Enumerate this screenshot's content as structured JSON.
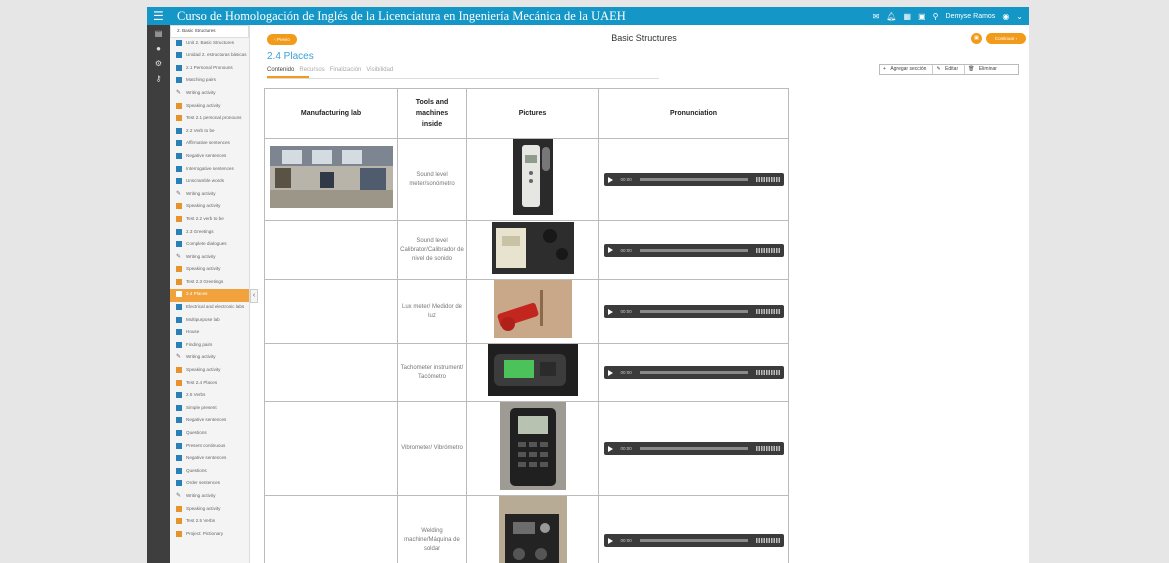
{
  "topbar": {
    "title": "Curso de Homologación de Inglés de la Licenciatura en Ingeniería Mecánica de la UAEH",
    "user": "Demyse Ramos"
  },
  "nav": {
    "items": [
      {
        "label": "2. Basic Structures",
        "kind": "head"
      },
      {
        "label": "Unit 2. Basic Structures",
        "kind": "doc"
      },
      {
        "label": "Unidad 2. estructuras básicas",
        "kind": "doc"
      },
      {
        "label": "2.1 Personal Pronouns",
        "kind": "doc"
      },
      {
        "label": "Matching pairs",
        "kind": "doc"
      },
      {
        "label": "Writing activity",
        "kind": "pen"
      },
      {
        "label": "Speaking activity",
        "kind": "spk"
      },
      {
        "label": "Test 2.1 personal pronouns",
        "kind": "spk"
      },
      {
        "label": "2.2 Verb to be",
        "kind": "doc"
      },
      {
        "label": "Affirmative sentences",
        "kind": "doc"
      },
      {
        "label": "Negative sentences",
        "kind": "doc"
      },
      {
        "label": "Interrogative sentences",
        "kind": "doc"
      },
      {
        "label": "Unscramble words",
        "kind": "doc"
      },
      {
        "label": "Writing activity",
        "kind": "pen"
      },
      {
        "label": "Speaking activity",
        "kind": "spk"
      },
      {
        "label": "Test 2.2 verb to be",
        "kind": "spk"
      },
      {
        "label": "2.3 Greetings",
        "kind": "doc"
      },
      {
        "label": "Complete dialogues",
        "kind": "doc"
      },
      {
        "label": "Writing activity",
        "kind": "pen"
      },
      {
        "label": "Speaking activity",
        "kind": "spk"
      },
      {
        "label": "Test 2.3 Greetings",
        "kind": "spk"
      },
      {
        "label": "2.4 Places",
        "kind": "active"
      },
      {
        "label": "Electrical and electronic labs",
        "kind": "doc"
      },
      {
        "label": "Multipurpose lab",
        "kind": "doc"
      },
      {
        "label": "House",
        "kind": "doc"
      },
      {
        "label": "Finding pairs",
        "kind": "doc"
      },
      {
        "label": "Writing activity",
        "kind": "pen"
      },
      {
        "label": "Speaking activity",
        "kind": "spk"
      },
      {
        "label": "Test 2.4 Places",
        "kind": "spk"
      },
      {
        "label": "2.5 Verbs",
        "kind": "doc"
      },
      {
        "label": "Simple present",
        "kind": "doc"
      },
      {
        "label": "Negative sentences",
        "kind": "doc"
      },
      {
        "label": "Questions",
        "kind": "doc"
      },
      {
        "label": "Present continuous",
        "kind": "doc"
      },
      {
        "label": "Negative sentences",
        "kind": "doc"
      },
      {
        "label": "Questions",
        "kind": "doc"
      },
      {
        "label": "Order sentences",
        "kind": "doc"
      },
      {
        "label": "Writing activity",
        "kind": "pen"
      },
      {
        "label": "Speaking activity",
        "kind": "spk"
      },
      {
        "label": "Test 2.5 Verbs",
        "kind": "spk"
      },
      {
        "label": "Project: Pictionary",
        "kind": "spk"
      }
    ]
  },
  "content": {
    "prev_label": "Previo",
    "next_label": "Continuar",
    "page_title": "Basic Structures",
    "section_title": "2.4 Places",
    "tabs": [
      "Contenido",
      "Recursos",
      "Finalización",
      "Visibilidad"
    ],
    "actions": {
      "add": "Agregar sección",
      "edit": "Editar",
      "delete": "Eliminar"
    }
  },
  "table": {
    "headers": [
      "Manufacturing lab",
      "Tools and machines inside",
      "Pictures",
      "Pronunciation"
    ],
    "rows": [
      {
        "tool": "Sound level meter/sonómetro",
        "audio_time": "00:00"
      },
      {
        "tool": "Sound level Calibrator/Calibrador de nivel de sonido",
        "audio_time": "00:00"
      },
      {
        "tool": "Lux meter/ Medidor de luz",
        "audio_time": "00:00"
      },
      {
        "tool": "Tachometer instrument/ Tacómetro",
        "audio_time": "00:00"
      },
      {
        "tool": "Vibrometer/ Vibrómetro",
        "audio_time": "00:00"
      },
      {
        "tool": "Welding machine/Máquina de soldar",
        "audio_time": "00:00"
      }
    ]
  },
  "colors": {
    "brand": "#1497c7",
    "accent": "#f29b1b",
    "sidebar": "#3e3e3e"
  }
}
